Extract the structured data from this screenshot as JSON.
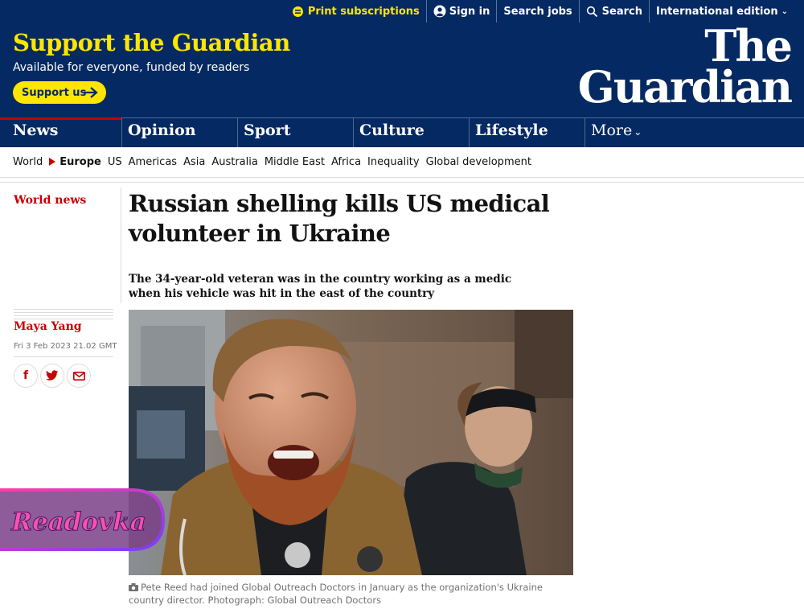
{
  "topbar": {
    "print_subscriptions": "Print subscriptions",
    "sign_in": "Sign in",
    "search_jobs": "Search jobs",
    "search": "Search",
    "edition": "International edition"
  },
  "header": {
    "support_title": "Support the Guardian",
    "support_subtitle": "Available for everyone, funded by readers",
    "support_button": "Support us",
    "logo_line1": "The",
    "logo_line2": "Guardian"
  },
  "nav": {
    "items": [
      "News",
      "Opinion",
      "Sport",
      "Culture",
      "Lifestyle"
    ],
    "more": "More"
  },
  "subnav": {
    "items": [
      "World",
      "Europe",
      "US",
      "Americas",
      "Asia",
      "Australia",
      "Middle East",
      "Africa",
      "Inequality",
      "Global development"
    ],
    "active": "Europe"
  },
  "article": {
    "section": "World news",
    "headline": "Russian shelling kills US medical volunteer in Ukraine",
    "standfirst": "The 34-year-old veteran was in the country working as a medic when his vehicle was hit in the east of the country",
    "byline": "Maya Yang",
    "date": "Fri 3 Feb 2023 21.02 GMT",
    "caption": "Pete Reed had joined Global Outreach Doctors in January as the organization's Ukraine country director. Photograph: Global Outreach Doctors"
  },
  "share": {
    "facebook": "f"
  },
  "watermark": {
    "text": "Readovka"
  },
  "colors": {
    "brand_blue": "#052962",
    "brand_yellow": "#ffe500",
    "news_red": "#c70000"
  }
}
